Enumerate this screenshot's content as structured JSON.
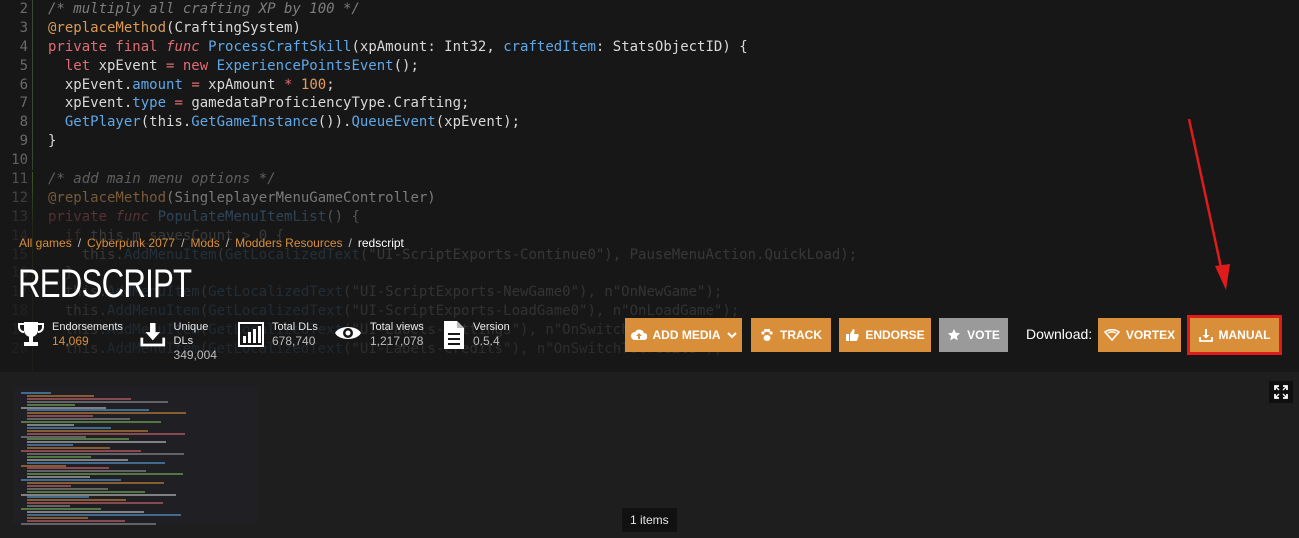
{
  "code_lines": [
    {
      "n": "2",
      "parts": [
        [
          "c-com",
          "/* multiply all crafting XP by 100 */"
        ]
      ]
    },
    {
      "n": "3",
      "parts": [
        [
          "c-ann",
          "@replaceMethod"
        ],
        [
          "",
          "(CraftingSystem)"
        ]
      ]
    },
    {
      "n": "4",
      "parts": [
        [
          "c-kw",
          "private final "
        ],
        [
          "c-kwi",
          "func "
        ],
        [
          "c-fn",
          "ProcessCraftSkill"
        ],
        [
          "",
          "(xpAmount: Int32, "
        ],
        [
          "c-fn",
          "craftedItem"
        ],
        [
          "",
          ": StatsObjectID) {"
        ]
      ]
    },
    {
      "n": "5",
      "parts": [
        [
          "",
          "  "
        ],
        [
          "c-kw",
          "let "
        ],
        [
          "",
          "xpEvent "
        ],
        [
          "c-op",
          "= "
        ],
        [
          "c-kw",
          "new "
        ],
        [
          "c-fn",
          "ExperiencePointsEvent"
        ],
        [
          "",
          "();"
        ]
      ]
    },
    {
      "n": "6",
      "parts": [
        [
          "",
          "  xpEvent."
        ],
        [
          "c-fn",
          "amount"
        ],
        [
          "",
          " "
        ],
        [
          "c-op",
          "= "
        ],
        [
          "",
          "xpAmount "
        ],
        [
          "c-op",
          "* "
        ],
        [
          "c-num",
          "100"
        ],
        [
          "",
          ";"
        ]
      ]
    },
    {
      "n": "7",
      "parts": [
        [
          "",
          "  xpEvent."
        ],
        [
          "c-fn",
          "type"
        ],
        [
          "",
          " "
        ],
        [
          "c-op",
          "= "
        ],
        [
          "",
          "gamedataProficiencyType.Crafting;"
        ]
      ]
    },
    {
      "n": "8",
      "parts": [
        [
          "",
          "  "
        ],
        [
          "c-fn",
          "GetPlayer"
        ],
        [
          "",
          "(this."
        ],
        [
          "c-fn",
          "GetGameInstance"
        ],
        [
          "",
          "())."
        ],
        [
          "c-fn",
          "QueueEvent"
        ],
        [
          "",
          "(xpEvent);"
        ]
      ]
    },
    {
      "n": "9",
      "parts": [
        [
          "",
          "}"
        ]
      ]
    },
    {
      "n": "10",
      "parts": [
        [
          "",
          ""
        ]
      ]
    },
    {
      "n": "11",
      "parts": [
        [
          "c-com",
          "/* add main menu options */"
        ]
      ]
    },
    {
      "n": "12",
      "parts": [
        [
          "c-ann",
          "@replaceMethod"
        ],
        [
          "",
          "(SingleplayerMenuGameController)"
        ]
      ]
    },
    {
      "n": "13",
      "parts": [
        [
          "c-kw",
          "private "
        ],
        [
          "c-kwi",
          "func "
        ],
        [
          "c-fn",
          "PopulateMenuItemList"
        ],
        [
          "",
          "() {"
        ]
      ]
    },
    {
      "n": "14",
      "parts": [
        [
          "",
          "  "
        ],
        [
          "c-kw",
          "if "
        ],
        [
          "",
          "this.m_savesCount > 0 {"
        ]
      ]
    },
    {
      "n": "15",
      "parts": [
        [
          "",
          "    this."
        ],
        [
          "c-fn",
          "AddMenuItem"
        ],
        [
          "",
          "("
        ],
        [
          "c-fn",
          "GetLocalizedText"
        ],
        [
          "",
          "(\"UI-ScriptExports-Continue0\"), PauseMenuAction.QuickLoad);"
        ]
      ]
    },
    {
      "n": "16",
      "parts": [
        [
          "",
          "  }"
        ]
      ]
    },
    {
      "n": "17",
      "parts": [
        [
          "",
          "  this."
        ],
        [
          "c-fn",
          "AddMenuItem"
        ],
        [
          "",
          "("
        ],
        [
          "c-fn",
          "GetLocalizedText"
        ],
        [
          "",
          "(\"UI-ScriptExports-NewGame0\"), n\"OnNewGame\");"
        ]
      ]
    },
    {
      "n": "18",
      "parts": [
        [
          "",
          "  this."
        ],
        [
          "c-fn",
          "AddMenuItem"
        ],
        [
          "",
          "("
        ],
        [
          "c-fn",
          "GetLocalizedText"
        ],
        [
          "",
          "(\"UI-ScriptExports-LoadGame0\"), n\"OnLoadGame\");"
        ]
      ]
    },
    {
      "n": "19",
      "parts": [
        [
          "",
          "  this."
        ],
        [
          "c-fn",
          "AddMenuItem"
        ],
        [
          "",
          "("
        ],
        [
          "c-fn",
          "GetLocalizedText"
        ],
        [
          "",
          "(\"UI-Labels-Settings\"), n\"OnSwitchToSettings\");"
        ]
      ]
    },
    {
      "n": "20",
      "parts": [
        [
          "",
          "  this."
        ],
        [
          "c-fn",
          "AddMenuItem"
        ],
        [
          "",
          "("
        ],
        [
          "c-fn",
          "GetLocalizedText"
        ],
        [
          "",
          "(\"UI-Labels-Credits\"), n\"OnSwitchToCredits\");"
        ]
      ]
    }
  ],
  "breadcrumb": {
    "items": [
      "All games",
      "Cyberpunk 2077",
      "Mods",
      "Modders Resources"
    ],
    "current": "redscript",
    "separator": "/"
  },
  "mod": {
    "title": "REDSCRIPT"
  },
  "stats": {
    "endorsements": {
      "label": "Endorsements",
      "value": "14,069",
      "icon": "trophy-icon"
    },
    "unique_dls": {
      "label": "Unique DLs",
      "value": "349,004",
      "icon": "download-icon"
    },
    "total_dls": {
      "label": "Total DLs",
      "value": "678,740",
      "icon": "bar-chart-icon"
    },
    "total_views": {
      "label": "Total views",
      "value": "1,217,078",
      "icon": "eye-icon"
    },
    "version": {
      "label": "Version",
      "value": "0.5.4",
      "icon": "document-icon"
    }
  },
  "actions": {
    "add_media": "ADD MEDIA",
    "track": "TRACK",
    "endorse": "ENDORSE",
    "vote": "VOTE"
  },
  "download": {
    "label": "Download:",
    "vortex": "VORTEX",
    "manual": "MANUAL"
  },
  "gallery": {
    "count_label": "1 items"
  },
  "colors": {
    "accent": "#d98f3a",
    "vote_button": "#9a9a9a",
    "highlight_red": "#e01b1b"
  }
}
